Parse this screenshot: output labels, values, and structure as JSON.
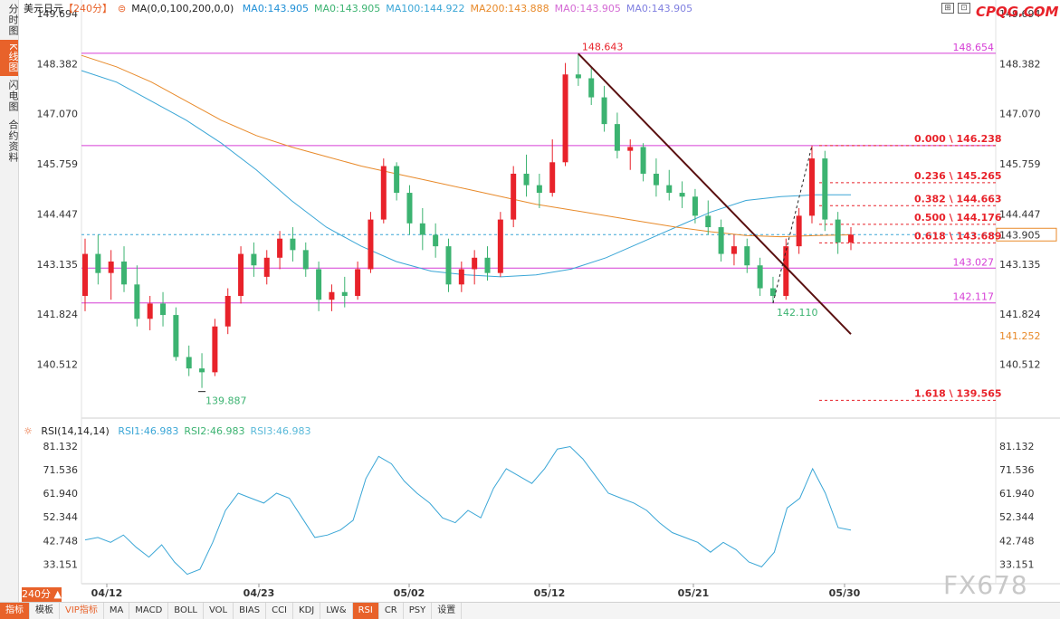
{
  "header": {
    "symbol": "美元日元",
    "period_tag": "【240分】",
    "ma_params": "MA(0,0,100,200,0,0)",
    "ma_values": [
      {
        "label": "MA0:143.905",
        "color": "#1f8fd6"
      },
      {
        "label": "MA0:143.905",
        "color": "#3cb371"
      },
      {
        "label": "MA100:144.922",
        "color": "#3aa6d6"
      },
      {
        "label": "MA200:143.888",
        "color": "#e88a2a"
      },
      {
        "label": "MA0:143.905",
        "color": "#d46ad4"
      },
      {
        "label": "MA0:143.905",
        "color": "#8080e0"
      }
    ]
  },
  "brand": "CPQG.COM",
  "watermark": "FX678",
  "sidebar": {
    "tabs": [
      "分时图",
      "K线图",
      "闪电图",
      "合约资料"
    ],
    "active": 1
  },
  "period_button": "240分 ▲",
  "bottom_bar": {
    "items": [
      "指标",
      "模板",
      "VIP指标",
      "MA",
      "MACD",
      "BOLL",
      "VOL",
      "BIAS",
      "CCI",
      "KDJ",
      "LW&",
      "RSI",
      "CR",
      "PSY",
      "设置"
    ]
  },
  "rsi_legend": {
    "title": "RSI(14,14,14)",
    "values": [
      {
        "label": "RSI1:46.983",
        "color": "#3aa6d6"
      },
      {
        "label": "RSI2:46.983",
        "color": "#3cb371"
      },
      {
        "label": "RSI3:46.983",
        "color": "#59b9d9"
      }
    ]
  },
  "chart_data": [
    {
      "type": "candlestick",
      "title": "美元日元【240分】",
      "xlabel": "",
      "ylabel": "",
      "x_ticks": [
        "04/12",
        "04/23",
        "05/02",
        "05/12",
        "05/21",
        "05/30"
      ],
      "y_ticks": [
        149.694,
        148.382,
        147.07,
        145.759,
        144.447,
        143.135,
        141.824,
        140.512
      ],
      "ylim": [
        139.1,
        149.86
      ],
      "current_price": "143.905",
      "price_marker": "141.252",
      "high_label": "148.643",
      "low_labels": [
        "139.887",
        "142.110"
      ],
      "horizontal_lines": [
        {
          "value": 148.654,
          "label": "148.654",
          "color": "#d63fd6"
        },
        {
          "value": 146.238,
          "label": "",
          "color": "#d63fd6"
        },
        {
          "value": 143.027,
          "label": "143.027",
          "color": "#d63fd6"
        },
        {
          "value": 142.117,
          "label": "142.117",
          "color": "#d63fd6"
        }
      ],
      "fibonacci": [
        {
          "label": "0.000 \\ 146.238",
          "value": 146.238
        },
        {
          "label": "0.236 \\ 145.265",
          "value": 145.265
        },
        {
          "label": "0.382 \\ 144.663",
          "value": 144.663
        },
        {
          "label": "0.500 \\ 144.176",
          "value": 144.176
        },
        {
          "label": "0.618 \\ 143.689",
          "value": 143.689
        },
        {
          "label": "1.618 \\ 139.565",
          "value": 139.565
        }
      ],
      "trend_line": {
        "from": [
          "05/12",
          148.643
        ],
        "to": [
          "05/30",
          141.3
        ]
      },
      "series": [
        {
          "name": "MA100",
          "color": "#3aa6d6",
          "values": [
            148.2,
            147.9,
            147.4,
            146.9,
            146.3,
            145.6,
            144.8,
            144.1,
            143.6,
            143.2,
            142.95,
            142.85,
            142.8,
            142.85,
            143.0,
            143.3,
            143.7,
            144.1,
            144.5,
            144.8,
            144.9,
            144.95,
            144.95
          ]
        },
        {
          "name": "MA200",
          "color": "#e88a2a",
          "values": [
            148.6,
            148.3,
            147.9,
            147.4,
            146.9,
            146.5,
            146.2,
            145.95,
            145.7,
            145.5,
            145.3,
            145.1,
            144.9,
            144.7,
            144.55,
            144.4,
            144.25,
            144.1,
            143.98,
            143.88,
            143.85,
            143.88,
            143.9
          ]
        }
      ],
      "candles": [
        {
          "o": 142.3,
          "h": 143.8,
          "l": 141.9,
          "c": 143.4
        },
        {
          "o": 143.4,
          "h": 143.9,
          "l": 142.6,
          "c": 142.9
        },
        {
          "o": 142.9,
          "h": 143.5,
          "l": 142.2,
          "c": 143.2
        },
        {
          "o": 143.2,
          "h": 143.6,
          "l": 142.4,
          "c": 142.6
        },
        {
          "o": 142.6,
          "h": 143.1,
          "l": 141.5,
          "c": 141.7
        },
        {
          "o": 141.7,
          "h": 142.3,
          "l": 141.4,
          "c": 142.1
        },
        {
          "o": 142.1,
          "h": 142.4,
          "l": 141.5,
          "c": 141.8
        },
        {
          "o": 141.8,
          "h": 142.0,
          "l": 140.6,
          "c": 140.7
        },
        {
          "o": 140.7,
          "h": 141.0,
          "l": 140.2,
          "c": 140.4
        },
        {
          "o": 140.4,
          "h": 140.8,
          "l": 139.89,
          "c": 140.3
        },
        {
          "o": 140.3,
          "h": 141.7,
          "l": 140.2,
          "c": 141.5
        },
        {
          "o": 141.5,
          "h": 142.5,
          "l": 141.3,
          "c": 142.3
        },
        {
          "o": 142.3,
          "h": 143.6,
          "l": 142.1,
          "c": 143.4
        },
        {
          "o": 143.4,
          "h": 143.7,
          "l": 142.8,
          "c": 143.1
        },
        {
          "o": 142.8,
          "h": 143.5,
          "l": 142.6,
          "c": 143.3
        },
        {
          "o": 143.3,
          "h": 144.0,
          "l": 143.0,
          "c": 143.8
        },
        {
          "o": 143.8,
          "h": 144.1,
          "l": 143.2,
          "c": 143.5
        },
        {
          "o": 143.5,
          "h": 143.7,
          "l": 142.8,
          "c": 143.0
        },
        {
          "o": 143.0,
          "h": 143.2,
          "l": 141.9,
          "c": 142.2
        },
        {
          "o": 142.2,
          "h": 142.6,
          "l": 141.9,
          "c": 142.4
        },
        {
          "o": 142.4,
          "h": 142.8,
          "l": 142.0,
          "c": 142.3
        },
        {
          "o": 142.3,
          "h": 143.2,
          "l": 142.2,
          "c": 143.0
        },
        {
          "o": 143.0,
          "h": 144.5,
          "l": 142.9,
          "c": 144.3
        },
        {
          "o": 144.3,
          "h": 145.9,
          "l": 144.2,
          "c": 145.7
        },
        {
          "o": 145.7,
          "h": 145.8,
          "l": 144.8,
          "c": 145.0
        },
        {
          "o": 145.0,
          "h": 145.2,
          "l": 143.9,
          "c": 144.2
        },
        {
          "o": 144.2,
          "h": 144.6,
          "l": 143.5,
          "c": 143.9
        },
        {
          "o": 143.9,
          "h": 144.2,
          "l": 143.3,
          "c": 143.6
        },
        {
          "o": 143.6,
          "h": 143.8,
          "l": 142.4,
          "c": 142.6
        },
        {
          "o": 142.6,
          "h": 143.2,
          "l": 142.4,
          "c": 143.0
        },
        {
          "o": 143.0,
          "h": 143.5,
          "l": 142.6,
          "c": 143.3
        },
        {
          "o": 143.3,
          "h": 143.6,
          "l": 142.7,
          "c": 142.9
        },
        {
          "o": 142.9,
          "h": 144.5,
          "l": 142.8,
          "c": 144.3
        },
        {
          "o": 144.3,
          "h": 145.7,
          "l": 144.1,
          "c": 145.5
        },
        {
          "o": 145.5,
          "h": 146.0,
          "l": 144.9,
          "c": 145.2
        },
        {
          "o": 145.2,
          "h": 145.5,
          "l": 144.6,
          "c": 145.0
        },
        {
          "o": 145.0,
          "h": 146.4,
          "l": 144.9,
          "c": 145.8
        },
        {
          "o": 145.8,
          "h": 148.4,
          "l": 145.7,
          "c": 148.1
        },
        {
          "o": 148.1,
          "h": 148.643,
          "l": 147.8,
          "c": 148.0
        },
        {
          "o": 148.0,
          "h": 148.3,
          "l": 147.3,
          "c": 147.5
        },
        {
          "o": 147.5,
          "h": 147.8,
          "l": 146.6,
          "c": 146.8
        },
        {
          "o": 146.8,
          "h": 147.1,
          "l": 145.9,
          "c": 146.1
        },
        {
          "o": 146.1,
          "h": 146.4,
          "l": 145.6,
          "c": 146.2
        },
        {
          "o": 146.2,
          "h": 146.3,
          "l": 145.3,
          "c": 145.5
        },
        {
          "o": 145.5,
          "h": 145.9,
          "l": 144.9,
          "c": 145.2
        },
        {
          "o": 145.2,
          "h": 145.6,
          "l": 144.8,
          "c": 145.0
        },
        {
          "o": 145.0,
          "h": 145.3,
          "l": 144.6,
          "c": 144.9
        },
        {
          "o": 144.9,
          "h": 145.1,
          "l": 144.2,
          "c": 144.4
        },
        {
          "o": 144.4,
          "h": 144.8,
          "l": 143.9,
          "c": 144.1
        },
        {
          "o": 144.1,
          "h": 144.3,
          "l": 143.2,
          "c": 143.4
        },
        {
          "o": 143.4,
          "h": 143.9,
          "l": 143.1,
          "c": 143.6
        },
        {
          "o": 143.6,
          "h": 143.8,
          "l": 142.9,
          "c": 143.1
        },
        {
          "o": 143.1,
          "h": 143.3,
          "l": 142.3,
          "c": 142.5
        },
        {
          "o": 142.5,
          "h": 142.8,
          "l": 142.11,
          "c": 142.3
        },
        {
          "o": 142.3,
          "h": 143.8,
          "l": 142.2,
          "c": 143.6
        },
        {
          "o": 143.6,
          "h": 144.6,
          "l": 143.4,
          "c": 144.4
        },
        {
          "o": 144.4,
          "h": 146.238,
          "l": 144.2,
          "c": 145.9
        },
        {
          "o": 145.9,
          "h": 146.1,
          "l": 144.0,
          "c": 144.3
        },
        {
          "o": 144.3,
          "h": 144.5,
          "l": 143.4,
          "c": 143.7
        },
        {
          "o": 143.7,
          "h": 144.1,
          "l": 143.5,
          "c": 143.905
        }
      ]
    },
    {
      "type": "line",
      "title": "RSI(14,14,14)",
      "xlabel": "",
      "ylabel": "",
      "y_ticks": [
        81.132,
        71.536,
        61.94,
        52.344,
        42.748,
        33.151
      ],
      "ylim": [
        27.0,
        84.5
      ],
      "series": [
        {
          "name": "RSI1",
          "color": "#3aa6d6",
          "values": [
            43,
            44,
            42,
            45,
            40,
            36,
            41,
            34,
            29,
            31,
            42,
            55,
            62,
            60,
            58,
            62,
            60,
            52,
            44,
            45,
            47,
            51,
            68,
            77,
            74,
            67,
            62,
            58,
            52,
            50,
            55,
            52,
            64,
            72,
            69,
            66,
            72,
            80,
            81,
            76,
            69,
            62,
            60,
            58,
            55,
            50,
            46,
            44,
            42,
            38,
            42,
            39,
            34,
            32,
            38,
            56,
            60,
            72,
            62,
            48,
            46.983
          ]
        }
      ]
    }
  ]
}
